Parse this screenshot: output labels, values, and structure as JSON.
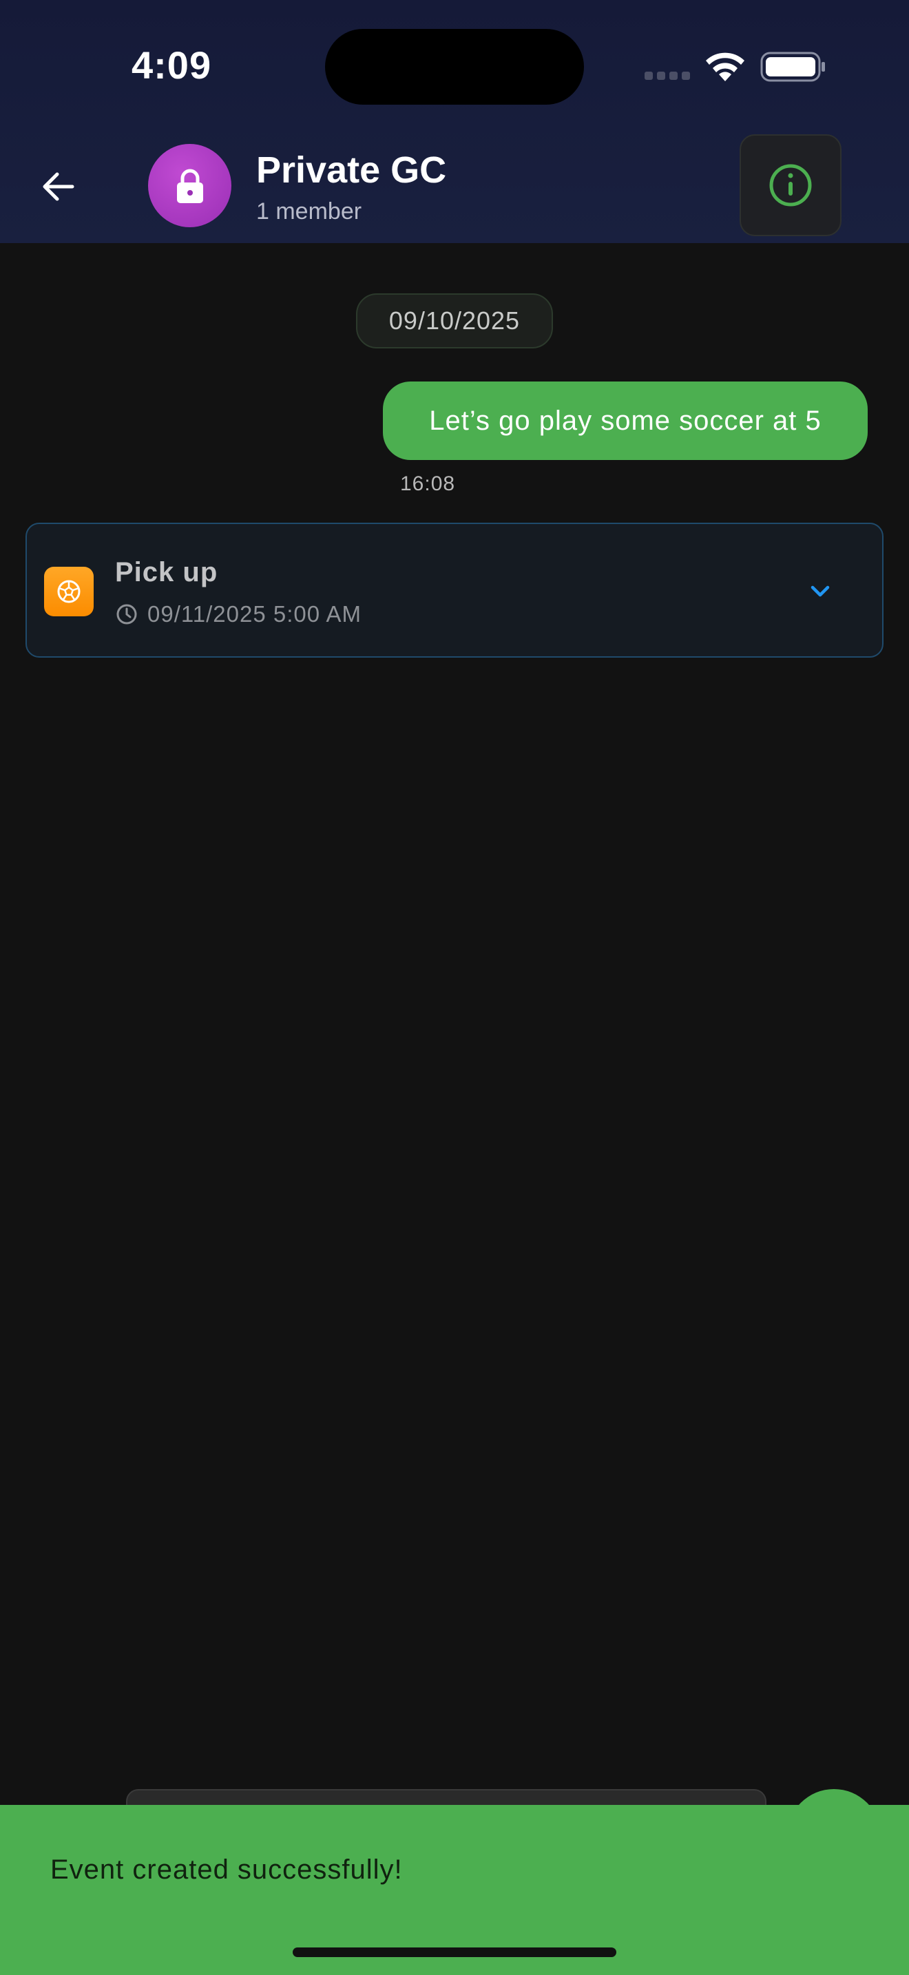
{
  "status_bar": {
    "time": "4:09"
  },
  "header": {
    "title": "Private GC",
    "subtitle": "1 member",
    "avatar_icon": "lock-icon",
    "back_icon": "arrow-left-icon",
    "info_icon": "info-icon"
  },
  "chat": {
    "date_separator": "09/10/2025",
    "messages": [
      {
        "text": "Let’s go play some soccer at 5",
        "time": "16:08",
        "outgoing": true
      }
    ]
  },
  "event_card": {
    "title": "Pick up",
    "datetime": "09/11/2025 5:00 AM",
    "icon": "soccer-ball-icon",
    "expand_icon": "chevron-down-icon"
  },
  "snackbar": {
    "message": "Event created successfully!"
  },
  "colors": {
    "accent_green": "#4caf50",
    "header_bg": "#151a38",
    "background": "#121212",
    "avatar_purple": "#a235bd",
    "event_orange": "#fb8c00",
    "link_blue": "#2196f3"
  }
}
